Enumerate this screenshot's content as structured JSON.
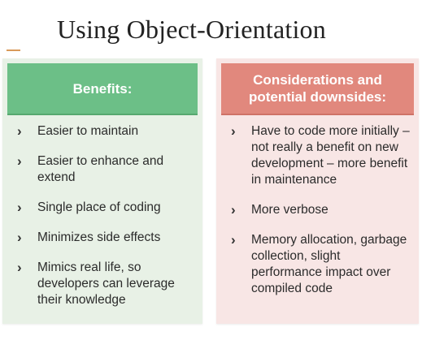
{
  "slide": {
    "title": "Using Object-Orientation"
  },
  "benefits": {
    "header": "Benefits:",
    "bullet": "›",
    "items": [
      "Easier to maintain",
      "Easier to enhance and extend",
      "Single place of coding",
      "Minimizes side effects",
      "Mimics real life, so developers can leverage their knowledge"
    ]
  },
  "downsides": {
    "header": "Considerations and potential downsides:",
    "bullet": "›",
    "items": [
      "Have to code more initially – not really a benefit on new development – more benefit in maintenance",
      "More verbose",
      "Memory allocation, garbage collection, slight performance impact over compiled code"
    ]
  },
  "colors": {
    "benefits_header": "#6cbf87",
    "benefits_bg": "#e8f1e6",
    "downsides_header": "#e1887d",
    "downsides_bg": "#f8e6e5",
    "accent": "#d99a5a"
  }
}
